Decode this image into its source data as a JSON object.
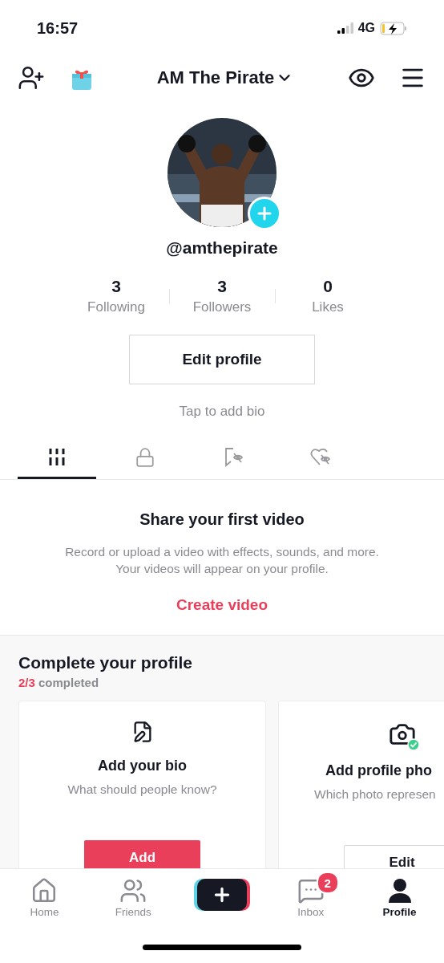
{
  "status_bar": {
    "time": "16:57",
    "network": "4G"
  },
  "header": {
    "title": "AM The Pirate"
  },
  "profile": {
    "handle": "@amthepirate",
    "stats": [
      {
        "value": "3",
        "label": "Following"
      },
      {
        "value": "3",
        "label": "Followers"
      },
      {
        "value": "0",
        "label": "Likes"
      }
    ],
    "edit_button": "Edit profile",
    "bio_prompt": "Tap to add bio"
  },
  "tabs": [
    {
      "kind": "grid",
      "selected": true
    },
    {
      "kind": "lock",
      "selected": false
    },
    {
      "kind": "bookmark",
      "selected": false
    },
    {
      "kind": "heart",
      "selected": false
    }
  ],
  "empty_state": {
    "title": "Share your first video",
    "description": "Record or upload a video with effects, sounds, and more.\nYour videos will appear on your profile.",
    "action": "Create video"
  },
  "complete_profile": {
    "title": "Complete your profile",
    "progress_count": "2/3",
    "progress_label": "completed",
    "cards": [
      {
        "kind": "bio",
        "title": "Add your bio",
        "subtitle": "What should people know?",
        "button": "Add",
        "completed": false
      },
      {
        "title": "Add profile pho",
        "subtitle": "Which photo represen",
        "button": "Edit",
        "completed": true
      }
    ]
  },
  "bottom_nav": [
    {
      "kind": "home",
      "label": "Home",
      "selected": false
    },
    {
      "kind": "friends",
      "label": "Friends",
      "selected": false
    },
    {
      "kind": "create",
      "selected": false
    },
    {
      "kind": "inbox",
      "label": "Inbox",
      "selected": false,
      "badge": "2"
    },
    {
      "kind": "profile",
      "label": "Profile",
      "selected": true
    }
  ]
}
